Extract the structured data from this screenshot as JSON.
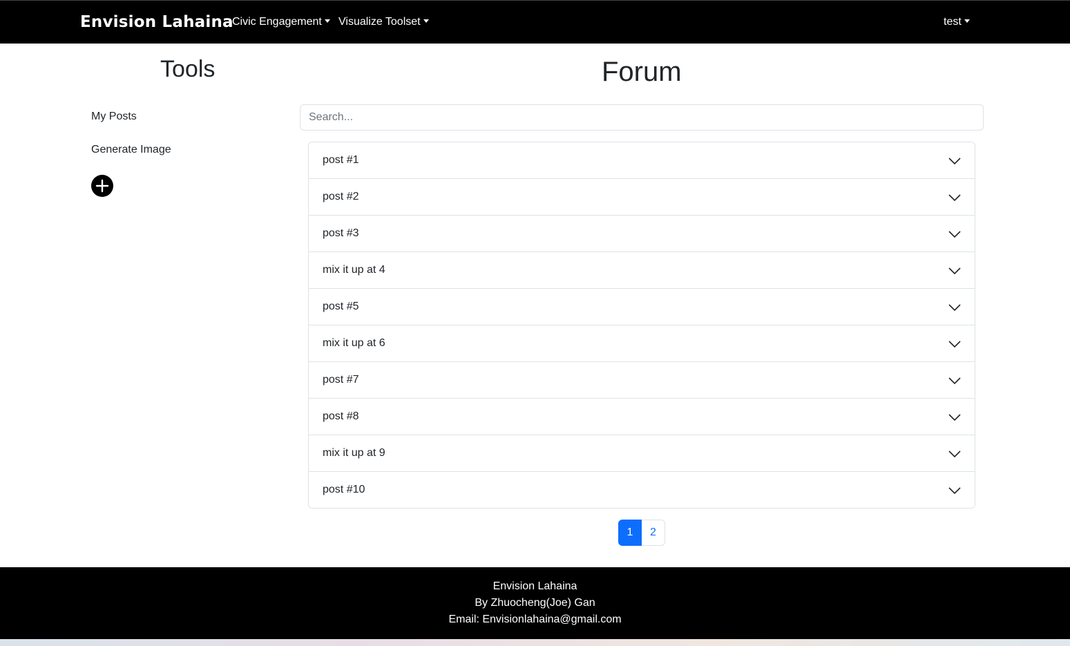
{
  "navbar": {
    "brand": "Envision Lahaina",
    "menus": [
      {
        "label": "Civic Engagement"
      },
      {
        "label": "Visualize Toolset"
      }
    ],
    "user": "test"
  },
  "sidebar": {
    "title": "Tools",
    "links": [
      {
        "label": "My Posts"
      },
      {
        "label": "Generate Image"
      }
    ],
    "add_icon": "plus-circle-icon"
  },
  "main": {
    "title": "Forum",
    "search": {
      "placeholder": "Search...",
      "value": ""
    },
    "posts": [
      {
        "title": "post #1"
      },
      {
        "title": "post #2"
      },
      {
        "title": "post #3"
      },
      {
        "title": "mix it up at 4"
      },
      {
        "title": "post #5"
      },
      {
        "title": "mix it up at 6"
      },
      {
        "title": "post #7"
      },
      {
        "title": "post #8"
      },
      {
        "title": "mix it up at 9"
      },
      {
        "title": "post #10"
      }
    ],
    "pagination": {
      "pages": [
        "1",
        "2"
      ],
      "current": "1"
    }
  },
  "footer": {
    "line1": "Envision Lahaina",
    "line2": "By Zhuocheng(Joe) Gan",
    "line3": "Email: Envisionlahaina@gmail.com"
  },
  "colors": {
    "navbar": "#000000",
    "accent": "#0d6efd",
    "footer": "#000000"
  }
}
